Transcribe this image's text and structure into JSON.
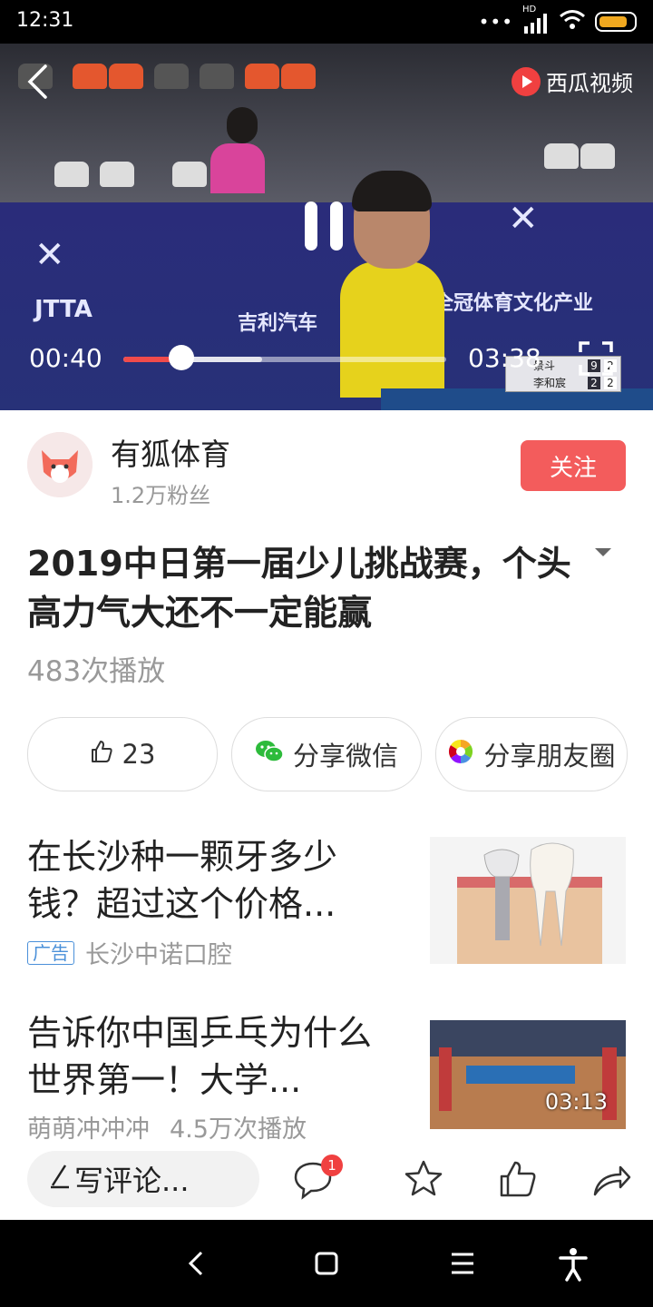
{
  "status": {
    "time": "12:31",
    "dots": "•••",
    "network": "HD"
  },
  "video": {
    "brand": "西瓜视频",
    "current_time": "00:40",
    "total_time": "03:38",
    "progress_fraction": 0.18,
    "buffered_fraction": 0.43,
    "scoreboard": {
      "rows": [
        {
          "name": "景斗",
          "game": "9",
          "set": "2"
        },
        {
          "name": "李和宸",
          "game": "2",
          "set": "2"
        }
      ]
    }
  },
  "author": {
    "name": "有狐体育",
    "fans": "1.2万粉丝",
    "follow_label": "关注"
  },
  "article": {
    "title": "2019中日第一届少儿挑战赛，个头高力气大还不一定能赢",
    "plays": "483次播放"
  },
  "actions": {
    "like_count": "23",
    "share_wechat": "分享微信",
    "share_moments": "分享朋友圈"
  },
  "feed": [
    {
      "title": "在长沙种一颗牙多少钱？超过这个价格...",
      "ad_tag": "广告",
      "source": "长沙中诺口腔"
    },
    {
      "title": "告诉你中国乒乓为什么世界第一！大学...",
      "source": "萌萌冲冲冲",
      "plays": "4.5万次播放",
      "duration": "03:13"
    }
  ],
  "bottom": {
    "comment_placeholder": "写评论...",
    "comment_badge": "1"
  }
}
